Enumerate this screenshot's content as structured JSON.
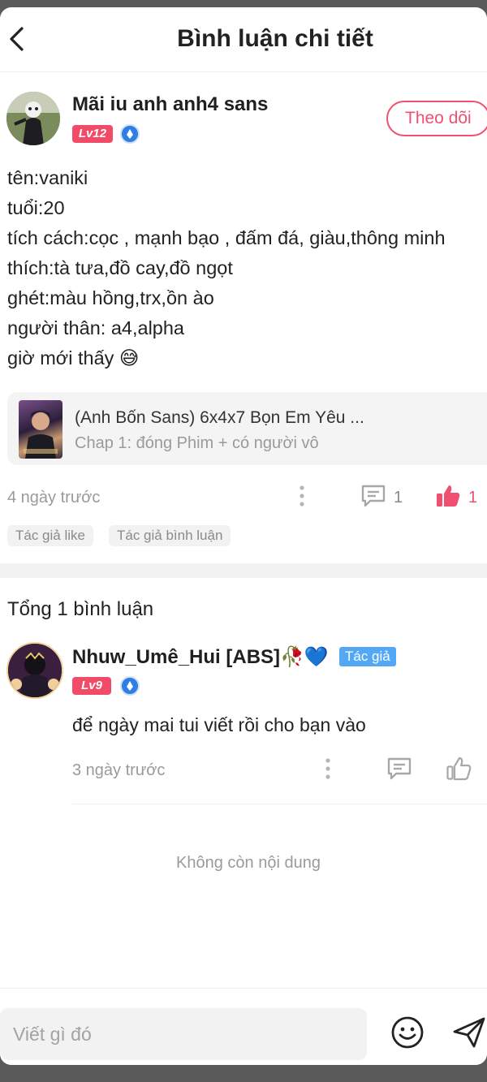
{
  "header": {
    "title": "Bình luận chi tiết"
  },
  "post": {
    "username": "Mãi iu anh anh4 sans",
    "level": "Lv12",
    "follow_label": "Theo dõi",
    "lines": [
      "tên:vaniki",
      "tuổi:20",
      "tích cách:cọc , mạnh bạo , đấm đá, giàu,thông minh",
      "thích:tà tưa,đồ cay,đồ ngọt",
      "ghét:màu hồng,trx,ồn ào",
      "người thân: a4,alpha",
      "giờ mới thấy 😅"
    ],
    "story": {
      "title": "(Anh Bốn Sans) 6x4x7 Bọn Em Yêu ...",
      "subtitle": "Chap 1: đóng Phim + có người vô"
    },
    "time": "4 ngày trước",
    "comment_count": "1",
    "like_count": "1",
    "tags": [
      "Tác giả like",
      "Tác giả bình luận"
    ]
  },
  "comments": {
    "total_label": "Tổng 1 bình luận",
    "items": [
      {
        "username": "Nhuw_Umê_Hui [ABS]🥀💙",
        "author_tag": "Tác giả",
        "level": "Lv9",
        "text": "để ngày mai tui viết rồi cho bạn vào",
        "time": "3 ngày trước"
      }
    ],
    "end_label": "Không còn nội dung"
  },
  "composer": {
    "placeholder": "Viết gì đó"
  },
  "colors": {
    "accent": "#f05070",
    "level_bg": "#f24b67",
    "author_tag": "#52a8f5",
    "badge": "#2f7ee3"
  },
  "icons": [
    "back-arrow-icon",
    "more-vertical-icon",
    "comment-icon",
    "thumbs-up-icon",
    "smiley-icon",
    "send-icon",
    "verified-badge-icon"
  ]
}
